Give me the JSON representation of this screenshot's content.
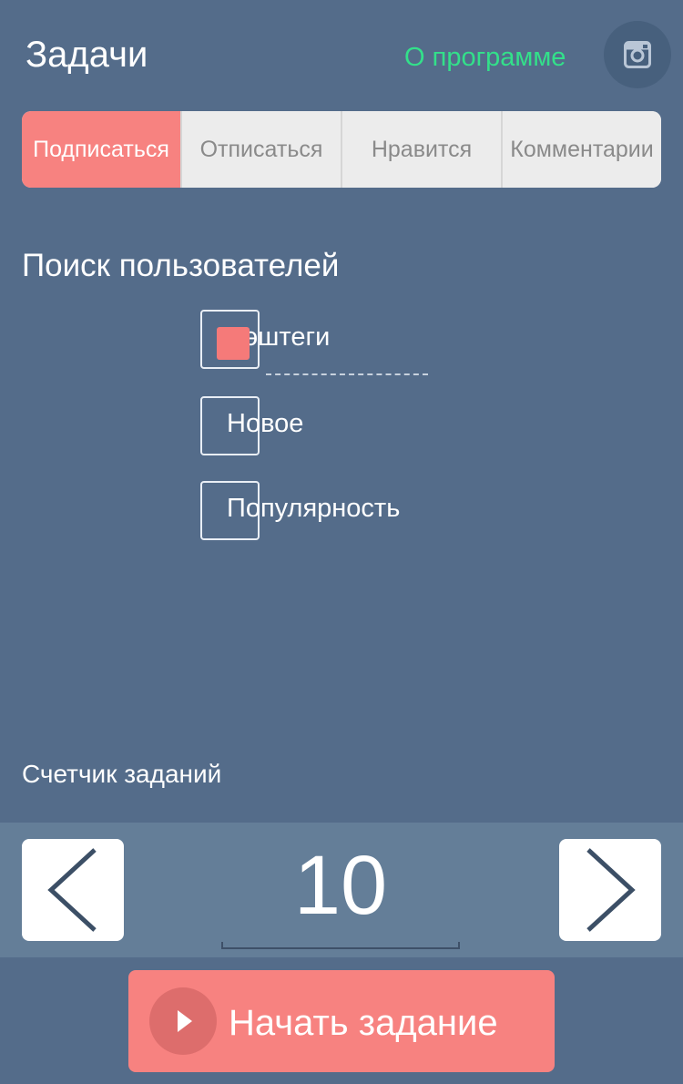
{
  "header": {
    "title": "Задачи",
    "about_label": "О программе",
    "instagram_icon": "instagram-icon"
  },
  "tabs": [
    {
      "label": "Подписаться",
      "active": true
    },
    {
      "label": "Отписаться",
      "active": false
    },
    {
      "label": "Нравится",
      "active": false
    },
    {
      "label": "Комментарии",
      "active": false
    }
  ],
  "search": {
    "title": "Поиск пользователей",
    "options": [
      {
        "label": "Хэштеги",
        "checked": true
      },
      {
        "label": "Новое",
        "checked": false
      },
      {
        "label": "Популярность",
        "checked": false
      }
    ]
  },
  "counter": {
    "title": "Счетчик заданий",
    "value": "10",
    "prev_icon": "chevron-left-icon",
    "next_icon": "chevron-right-icon"
  },
  "start": {
    "label": "Начать задание",
    "icon": "play-icon"
  },
  "colors": {
    "background": "#546c8a",
    "accent": "#f78280",
    "link": "#33e08a"
  }
}
